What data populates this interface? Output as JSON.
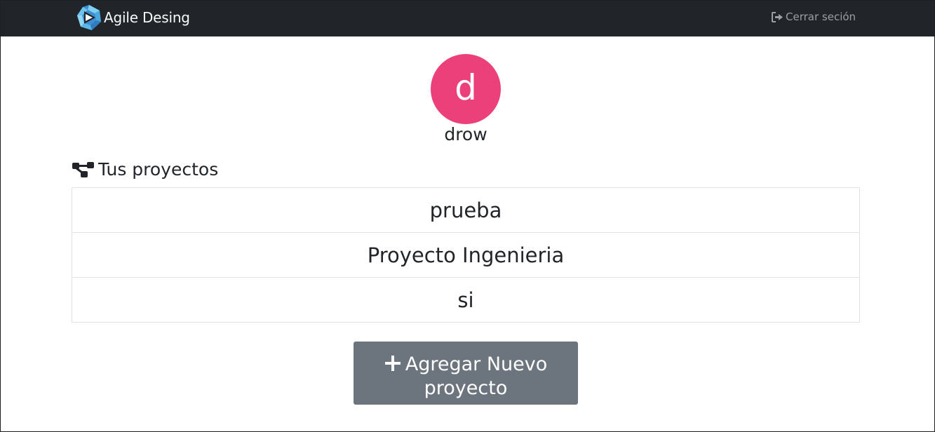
{
  "navbar": {
    "brand": "Agile Desing",
    "logout_label": "Cerrar seción"
  },
  "profile": {
    "avatar_letter": "d",
    "avatar_color": "#ec407a",
    "username": "drow"
  },
  "projects": {
    "title": "Tus proyectos",
    "icon": "sitemap-icon",
    "items": [
      {
        "name": "prueba"
      },
      {
        "name": "Proyecto Ingenieria"
      },
      {
        "name": "si"
      }
    ]
  },
  "actions": {
    "add_project_line1": "Agregar Nuevo",
    "add_project_line2": "proyecto",
    "add_icon": "plus-icon"
  },
  "colors": {
    "navbar_bg": "#212529",
    "button_bg": "#6c757d",
    "logo_blue": "#5bc0eb"
  }
}
